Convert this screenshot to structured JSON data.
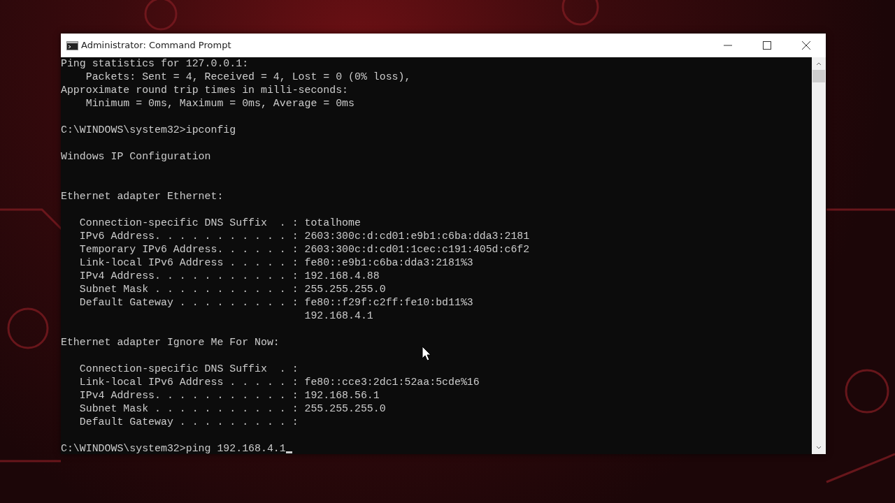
{
  "window": {
    "title": "Administrator: Command Prompt"
  },
  "console": {
    "blocks": [
      {
        "kind": "output",
        "lines": [
          "Ping statistics for 127.0.0.1:",
          "    Packets: Sent = 4, Received = 4, Lost = 0 (0% loss),",
          "Approximate round trip times in milli-seconds:",
          "    Minimum = 0ms, Maximum = 0ms, Average = 0ms"
        ]
      },
      {
        "kind": "command",
        "lines": [
          "C:\\WINDOWS\\system32>ipconfig"
        ]
      },
      {
        "kind": "heading",
        "lines": [
          "Windows IP Configuration"
        ]
      },
      {
        "kind": "output",
        "lines": [
          "Ethernet adapter Ethernet:"
        ]
      },
      {
        "kind": "output",
        "lines": [
          "   Connection-specific DNS Suffix  . : totalhome",
          "   IPv6 Address. . . . . . . . . . . : 2603:300c:d:cd01:e9b1:c6ba:dda3:2181",
          "   Temporary IPv6 Address. . . . . . : 2603:300c:d:cd01:1cec:c191:405d:c6f2",
          "   Link-local IPv6 Address . . . . . : fe80::e9b1:c6ba:dda3:2181%3",
          "   IPv4 Address. . . . . . . . . . . : 192.168.4.88",
          "   Subnet Mask . . . . . . . . . . . : 255.255.255.0",
          "   Default Gateway . . . . . . . . . : fe80::f29f:c2ff:fe10:bd11%3",
          "                                       192.168.4.1"
        ]
      },
      {
        "kind": "output",
        "lines": [
          "Ethernet adapter Ignore Me For Now:"
        ]
      },
      {
        "kind": "output",
        "lines": [
          "   Connection-specific DNS Suffix  . :",
          "   Link-local IPv6 Address . . . . . : fe80::cce3:2dc1:52aa:5cde%16",
          "   IPv4 Address. . . . . . . . . . . : 192.168.56.1",
          "   Subnet Mask . . . . . . . . . . . : 255.255.255.0",
          "   Default Gateway . . . . . . . . . :"
        ]
      },
      {
        "kind": "command",
        "lines": [
          "C:\\WINDOWS\\system32>ping 192.168.4.1"
        ],
        "cursor": true
      }
    ]
  }
}
